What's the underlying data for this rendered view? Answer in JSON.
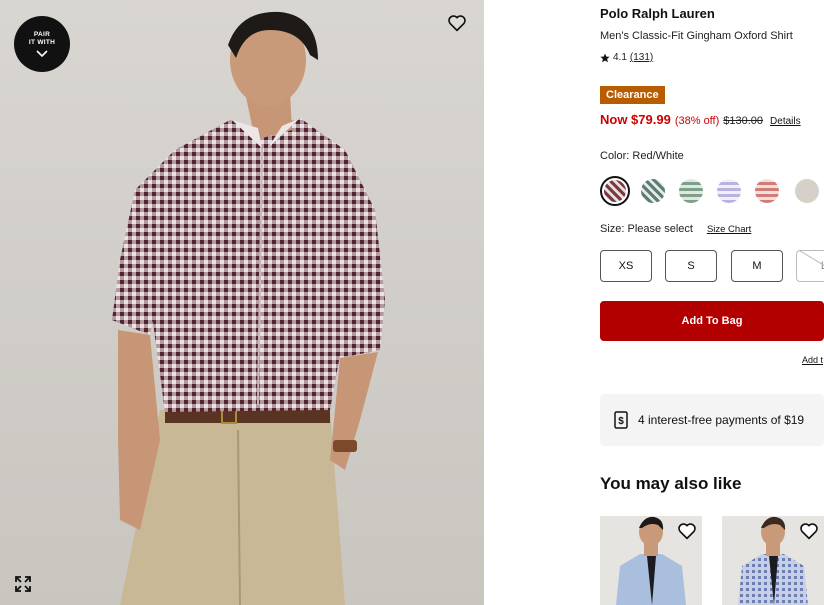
{
  "hero": {
    "pair_badge": [
      "PAIR",
      "IT WITH"
    ]
  },
  "product": {
    "brand": "Polo Ralph Lauren",
    "name": "Men's Classic-Fit Gingham Oxford Shirt",
    "rating": "4.1",
    "review_count": "(131)",
    "badge": "Clearance",
    "price_now": "Now $79.99",
    "price_off": "(38% off)",
    "price_original": "$130.00",
    "price_details": "Details",
    "color_label": "Color: Red/White",
    "swatches": [
      {
        "name": "Red/White",
        "color": "#7a3a3e",
        "selected": true
      },
      {
        "name": "Green Multi",
        "color": "#6a8a82",
        "selected": false
      },
      {
        "name": "Green/White",
        "color": "#7fa088",
        "selected": false
      },
      {
        "name": "Lavender/White",
        "color": "#c9c4e4",
        "selected": false
      },
      {
        "name": "Coral/White",
        "color": "#d48a86",
        "selected": false
      },
      {
        "name": "Beige",
        "color": "#d6d1c8",
        "selected": false
      }
    ],
    "size_label": "Size: Please select",
    "size_chart": "Size Chart",
    "sizes": [
      "XS",
      "S",
      "M",
      "L"
    ],
    "add_to_bag": "Add To Bag",
    "add_to_list": "Add t",
    "installments": "4 interest-free payments of $19",
    "recommendations_title": "You may also like"
  },
  "colors": {
    "accent_red": "#b20000",
    "price_red": "#cc0000",
    "clearance": "#b85c00"
  }
}
